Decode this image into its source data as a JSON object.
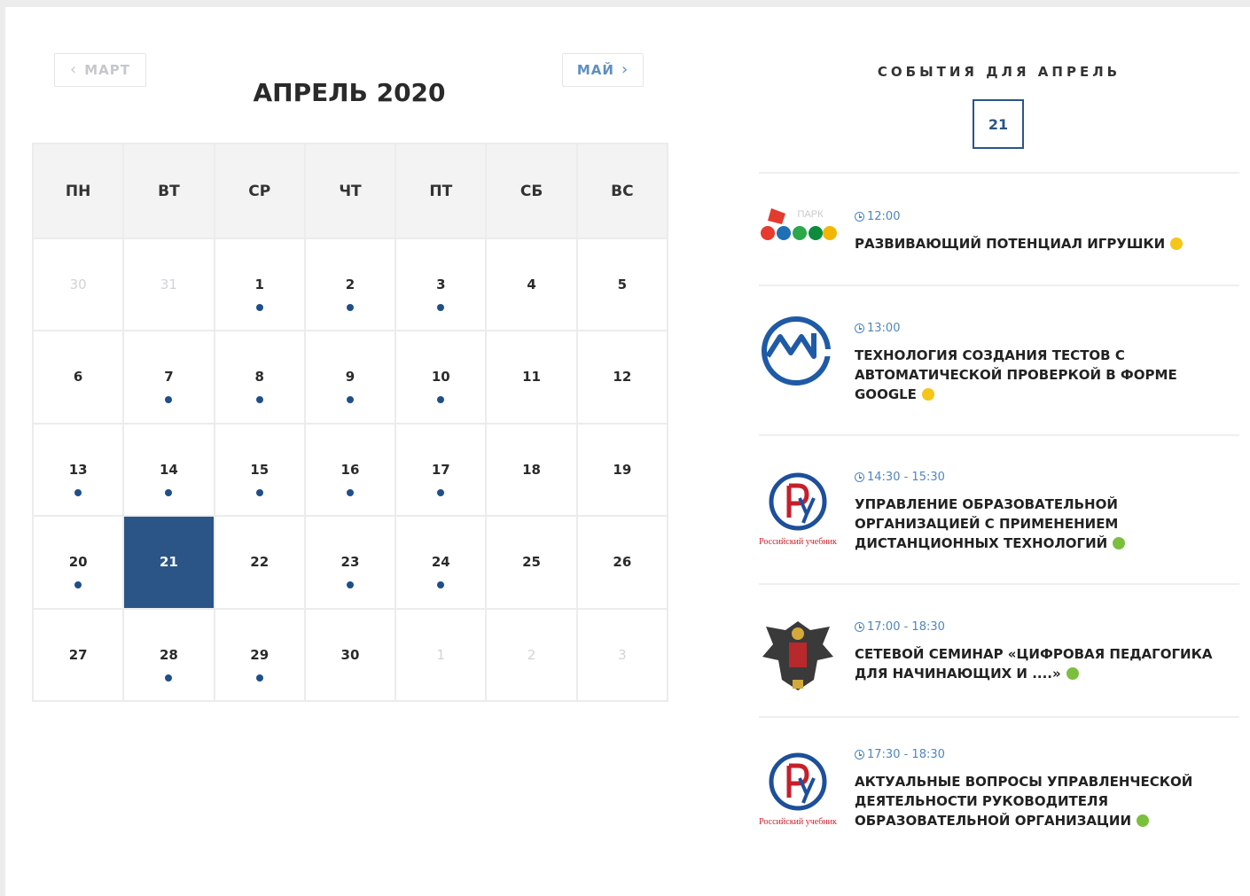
{
  "calendar": {
    "prev_label": "МАРТ",
    "next_label": "МАЙ",
    "month_title": "АПРЕЛЬ 2020",
    "weekdays": [
      "ПН",
      "ВТ",
      "СР",
      "ЧТ",
      "ПТ",
      "СБ",
      "ВС"
    ],
    "days": [
      {
        "n": "30",
        "muted": true,
        "dot": false
      },
      {
        "n": "31",
        "muted": true,
        "dot": false
      },
      {
        "n": "1",
        "muted": false,
        "dot": true
      },
      {
        "n": "2",
        "muted": false,
        "dot": true
      },
      {
        "n": "3",
        "muted": false,
        "dot": true
      },
      {
        "n": "4",
        "muted": false,
        "dot": false
      },
      {
        "n": "5",
        "muted": false,
        "dot": false
      },
      {
        "n": "6",
        "muted": false,
        "dot": false
      },
      {
        "n": "7",
        "muted": false,
        "dot": true
      },
      {
        "n": "8",
        "muted": false,
        "dot": true
      },
      {
        "n": "9",
        "muted": false,
        "dot": true
      },
      {
        "n": "10",
        "muted": false,
        "dot": true
      },
      {
        "n": "11",
        "muted": false,
        "dot": false
      },
      {
        "n": "12",
        "muted": false,
        "dot": false
      },
      {
        "n": "13",
        "muted": false,
        "dot": true
      },
      {
        "n": "14",
        "muted": false,
        "dot": true
      },
      {
        "n": "15",
        "muted": false,
        "dot": true
      },
      {
        "n": "16",
        "muted": false,
        "dot": true
      },
      {
        "n": "17",
        "muted": false,
        "dot": true
      },
      {
        "n": "18",
        "muted": false,
        "dot": false
      },
      {
        "n": "19",
        "muted": false,
        "dot": false
      },
      {
        "n": "20",
        "muted": false,
        "dot": true
      },
      {
        "n": "21",
        "muted": false,
        "dot": false,
        "selected": true
      },
      {
        "n": "22",
        "muted": false,
        "dot": false
      },
      {
        "n": "23",
        "muted": false,
        "dot": true
      },
      {
        "n": "24",
        "muted": false,
        "dot": true
      },
      {
        "n": "25",
        "muted": false,
        "dot": false
      },
      {
        "n": "26",
        "muted": false,
        "dot": false
      },
      {
        "n": "27",
        "muted": false,
        "dot": false
      },
      {
        "n": "28",
        "muted": false,
        "dot": true
      },
      {
        "n": "29",
        "muted": false,
        "dot": true
      },
      {
        "n": "30",
        "muted": false,
        "dot": false
      },
      {
        "n": "1",
        "muted": true,
        "dot": false
      },
      {
        "n": "2",
        "muted": true,
        "dot": false
      },
      {
        "n": "3",
        "muted": true,
        "dot": false
      }
    ]
  },
  "events_panel": {
    "title": "СОБЫТИЯ ДЛЯ АПРЕЛЬ",
    "selected_date": "21",
    "events": [
      {
        "time": "12:00",
        "name": "Развивающий потенциал игрушки",
        "status_color": "#f5c518",
        "logo": "park-logo-icon",
        "logo_text": "ПАРК"
      },
      {
        "time": "13:00",
        "name": "Технология создания тестов с автоматической проверкой в форме Google",
        "status_color": "#f5c518",
        "logo": "m-circle-logo-icon"
      },
      {
        "time": "14:30 - 15:30",
        "name": "Управление образовательной организацией с применением дистанционных технологий",
        "status_color": "#7cbf3f",
        "logo": "russian-textbook-logo-icon",
        "logo_text": "Российский учебник"
      },
      {
        "time": "17:00 - 18:30",
        "name": "Сетевой семинар «Цифровая педагогика для начинающих и ....»",
        "status_color": "#7cbf3f",
        "logo": "eagle-emblem-icon"
      },
      {
        "time": "17:30 - 18:30",
        "name": "Актуальные вопросы управленческой деятельности руководителя образовательной организации",
        "status_color": "#7cbf3f",
        "logo": "russian-textbook-logo-icon",
        "logo_text": "Российский учебник"
      }
    ]
  }
}
